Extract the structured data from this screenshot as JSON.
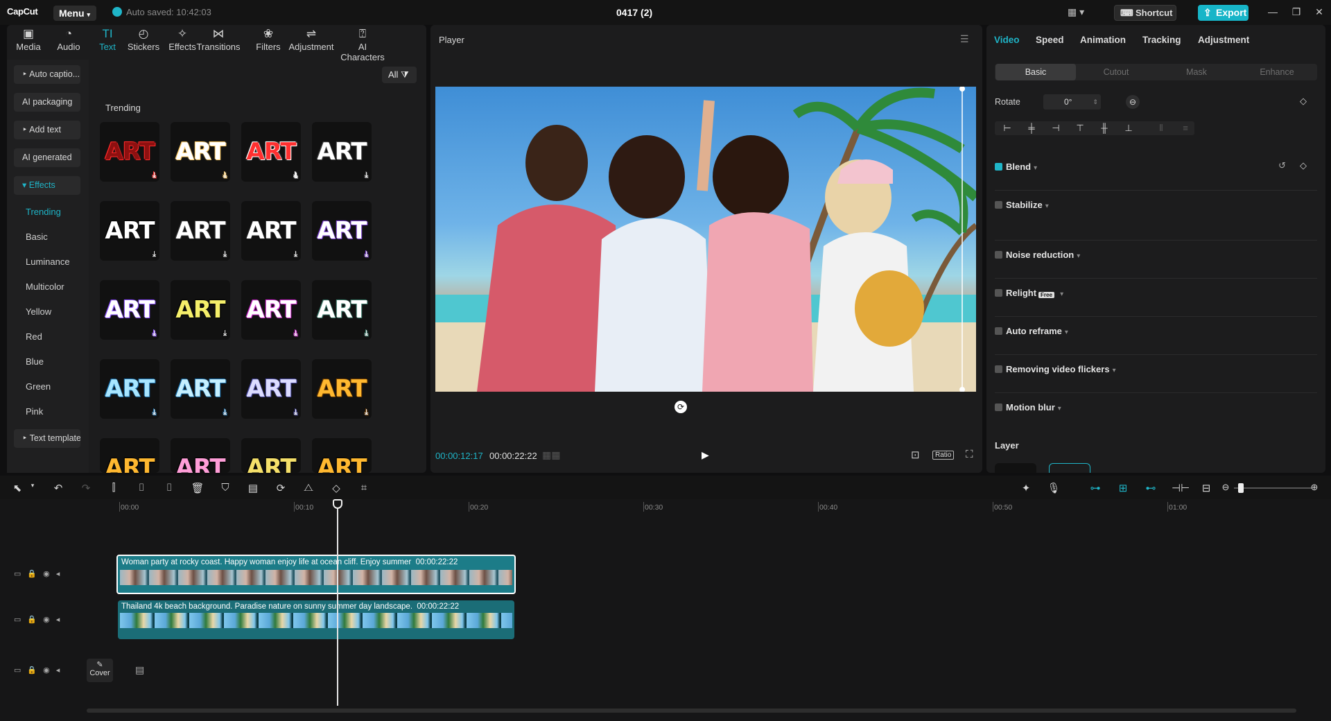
{
  "app": {
    "logo": "CapCut",
    "menu_label": "Menu",
    "autosave": "Auto saved: 10:42:03",
    "project_title": "0417 (2)",
    "shortcut_label": "Shortcut",
    "export_label": "Export",
    "accent": "#1fb5c8"
  },
  "top_tabs": [
    {
      "label": "Media",
      "icon": "▣"
    },
    {
      "label": "Audio",
      "icon": "◔"
    },
    {
      "label": "Text",
      "icon": "TI"
    },
    {
      "label": "Stickers",
      "icon": "◴"
    },
    {
      "label": "Effects",
      "icon": "✧"
    },
    {
      "label": "Transitions",
      "icon": "⋈"
    },
    {
      "label": "Filters",
      "icon": "❀"
    },
    {
      "label": "Adjustment",
      "icon": "⇌"
    },
    {
      "label": "AI Characters",
      "icon": "⍰"
    }
  ],
  "side_nav": {
    "auto_captions": "Auto captio...",
    "ai_packaging": "AI packaging",
    "add_text": "Add text",
    "ai_generated": "AI generated",
    "effects": "Effects",
    "sub": [
      "Trending",
      "Basic",
      "Luminance",
      "Multicolor",
      "Yellow",
      "Red",
      "Blue",
      "Green",
      "Pink"
    ],
    "text_template": "Text template"
  },
  "filter_label": "All",
  "section_title": "Trending",
  "art_label": "ART",
  "art_styles": [
    {
      "color": "#8e1010",
      "shadow": "#ff2a2a"
    },
    {
      "color": "#ffffff",
      "shadow": "#ffcc66"
    },
    {
      "color": "#ff3030",
      "shadow": "#ffffff"
    },
    {
      "color": "#ffffff",
      "shadow": "#444444"
    },
    {
      "color": "#ffffff",
      "shadow": "#000000"
    },
    {
      "color": "#ffffff",
      "shadow": "#333333"
    },
    {
      "color": "#ffffff",
      "shadow": "#222222"
    },
    {
      "color": "#ffffff",
      "shadow": "#7b3fd0"
    },
    {
      "color": "#ffffff",
      "shadow": "#8a4dff"
    },
    {
      "color": "#f5ef6a",
      "shadow": "#000000"
    },
    {
      "color": "#ffffff",
      "shadow": "#d02ad0"
    },
    {
      "color": "#ffffff",
      "shadow": "#3a7a6a"
    },
    {
      "color": "#a8e6ff",
      "shadow": "#1a6da8"
    },
    {
      "color": "#c6f0ff",
      "shadow": "#1a6da8"
    },
    {
      "color": "#dcdcff",
      "shadow": "#4a4aa0"
    },
    {
      "color": "#ffb830",
      "shadow": "#6a3a00"
    },
    {
      "color": "#ffb830",
      "shadow": "#000000"
    },
    {
      "color": "#ff9ed8",
      "shadow": "#000000"
    },
    {
      "color": "#f5e06a",
      "shadow": "#000000"
    },
    {
      "color": "#ffb830",
      "shadow": "#000000"
    }
  ],
  "player": {
    "title": "Player",
    "time_current": "00:00:12:17",
    "time_total": "00:00:22:22",
    "ratio_label": "Ratio"
  },
  "right_tabs": [
    "Video",
    "Speed",
    "Animation",
    "Tracking",
    "Adjustment"
  ],
  "sub_tabs": [
    "Basic",
    "Cutout",
    "Mask",
    "Enhance"
  ],
  "rotate": {
    "label": "Rotate",
    "value": "0°"
  },
  "properties": [
    {
      "label": "Blend",
      "checked": true
    },
    {
      "label": "Stabilize",
      "checked": false
    },
    {
      "label": "Noise reduction",
      "checked": false
    },
    {
      "label": "Relight",
      "checked": false
    },
    {
      "label": "Auto reframe",
      "checked": false
    },
    {
      "label": "Removing video flickers",
      "checked": false
    },
    {
      "label": "Motion blur",
      "checked": false
    }
  ],
  "relight_badge": "Free",
  "layer_label": "Layer",
  "ruler": [
    "00:00",
    "00:10",
    "00:20",
    "00:30",
    "00:40",
    "00:50",
    "01:00"
  ],
  "clips": [
    {
      "label": "Woman party at rocky coast. Happy woman enjoy life at ocean cliff. Enjoy summer",
      "duration": "00:00:22:22"
    },
    {
      "label": "Thailand 4k beach background. Paradise nature on sunny summer day landscape.",
      "duration": "00:00:22:22"
    }
  ],
  "cover_label": "Cover"
}
